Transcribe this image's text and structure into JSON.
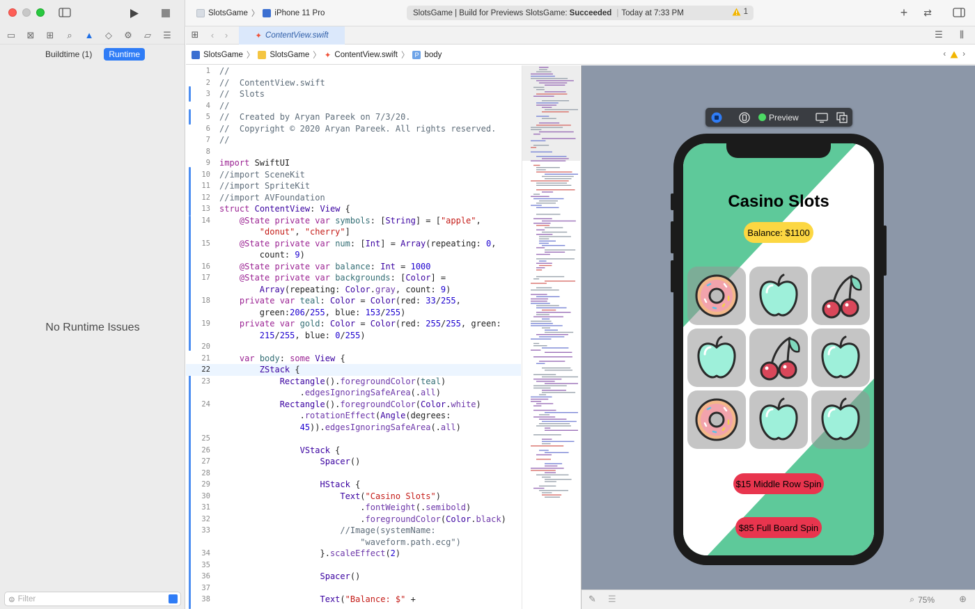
{
  "titlebar": {
    "scheme_project": "SlotsGame",
    "scheme_device": "iPhone 11 Pro",
    "activity_prefix": "SlotsGame | Build for Previews SlotsGame:",
    "activity_status": "Succeeded",
    "activity_time": "Today at 7:33 PM",
    "warning_count": "1"
  },
  "navigator": {
    "segments": [
      "Buildtime (1)",
      "Runtime"
    ],
    "selected_segment": "Runtime",
    "empty_message": "No Runtime Issues",
    "filter_placeholder": "Filter"
  },
  "editor": {
    "tab_label": "ContentView.swift",
    "breadcrumb": [
      "SlotsGame",
      "SlotsGame",
      "ContentView.swift",
      "body"
    ],
    "current_line": "22"
  },
  "code_lines": [
    {
      "n": "1",
      "html": "<span class=\"cm\">//</span>"
    },
    {
      "n": "2",
      "html": "<span class=\"cm\">//  ContentView.swift</span>"
    },
    {
      "n": "3",
      "html": "<span class=\"cm\">//  Slots</span>"
    },
    {
      "n": "4",
      "html": "<span class=\"cm\">//</span>"
    },
    {
      "n": "5",
      "html": "<span class=\"cm\">//  Created by Aryan Pareek on 7/3/20.</span>"
    },
    {
      "n": "6",
      "html": "<span class=\"cm\">//  Copyright © 2020 Aryan Pareek. All rights reserved.</span>"
    },
    {
      "n": "7",
      "html": "<span class=\"cm\">//</span>"
    },
    {
      "n": "8",
      "html": ""
    },
    {
      "n": "9",
      "html": "<span class=\"kw\">import</span> SwiftUI"
    },
    {
      "n": "10",
      "html": "<span class=\"cm\">//import SceneKit</span>"
    },
    {
      "n": "11",
      "html": "<span class=\"cm\">//import SpriteKit</span>"
    },
    {
      "n": "12",
      "html": "<span class=\"cm\">//import AVFoundation</span>"
    },
    {
      "n": "13",
      "html": "<span class=\"kw\">struct</span> <span class=\"ty\">ContentView</span>: <span class=\"ty\">View</span> {"
    },
    {
      "n": "14",
      "html": "    <span class=\"kw\">@State private var</span> <span class=\"pr\">symbols</span>: [<span class=\"ty\">String</span>] = [<span class=\"st\">\"apple\"</span>,"
    },
    {
      "n": "",
      "html": "        <span class=\"st\">\"donut\"</span>, <span class=\"st\">\"cherry\"</span>]"
    },
    {
      "n": "15",
      "html": "    <span class=\"kw\">@State private var</span> <span class=\"pr\">num</span>: [<span class=\"ty\">Int</span>] = <span class=\"ty\">Array</span>(repeating: <span class=\"nm\">0</span>,"
    },
    {
      "n": "",
      "html": "        count: <span class=\"nm\">9</span>)"
    },
    {
      "n": "16",
      "html": "    <span class=\"kw\">@State private var</span> <span class=\"pr\">balance</span>: <span class=\"ty\">Int</span> = <span class=\"nm\">1000</span>"
    },
    {
      "n": "17",
      "html": "    <span class=\"kw\">@State private var</span> <span class=\"pr\">backgrounds</span>: [<span class=\"ty\">Color</span>] ="
    },
    {
      "n": "",
      "html": "        <span class=\"ty\">Array</span>(repeating: <span class=\"ty\">Color</span>.<span class=\"fn\">gray</span>, count: <span class=\"nm\">9</span>)"
    },
    {
      "n": "18",
      "html": "    <span class=\"kw\">private var</span> <span class=\"pr\">teal</span>: <span class=\"ty\">Color</span> = <span class=\"ty\">Color</span>(red: <span class=\"nm\">33</span>/<span class=\"nm\">255</span>,"
    },
    {
      "n": "",
      "html": "        green:<span class=\"nm\">206</span>/<span class=\"nm\">255</span>, blue: <span class=\"nm\">153</span>/<span class=\"nm\">255</span>)"
    },
    {
      "n": "19",
      "html": "    <span class=\"kw\">private var</span> <span class=\"pr\">gold</span>: <span class=\"ty\">Color</span> = <span class=\"ty\">Color</span>(red: <span class=\"nm\">255</span>/<span class=\"nm\">255</span>, green:"
    },
    {
      "n": "",
      "html": "        <span class=\"nm\">215</span>/<span class=\"nm\">255</span>, blue: <span class=\"nm\">0</span>/<span class=\"nm\">255</span>)"
    },
    {
      "n": "20",
      "html": ""
    },
    {
      "n": "21",
      "html": "    <span class=\"kw\">var</span> <span class=\"pr\">body</span>: <span class=\"kw\">some</span> <span class=\"ty\">View</span> {"
    },
    {
      "n": "22",
      "html": "        <span class=\"ty\">ZStack</span> {"
    },
    {
      "n": "23",
      "html": "            <span class=\"ty\">Rectangle</span>().<span class=\"fn\">foregroundColor</span>(<span class=\"pr\">teal</span>)"
    },
    {
      "n": "",
      "html": "                .<span class=\"fn\">edgesIgnoringSafeArea</span>(.<span class=\"fn\">all</span>)"
    },
    {
      "n": "24",
      "html": "            <span class=\"ty\">Rectangle</span>().<span class=\"fn\">foregroundColor</span>(<span class=\"ty\">Color</span>.<span class=\"fn\">white</span>)"
    },
    {
      "n": "",
      "html": "                .<span class=\"fn\">rotationEffect</span>(<span class=\"ty\">Angle</span>(degrees:"
    },
    {
      "n": "",
      "html": "                <span class=\"nm\">45</span>)).<span class=\"fn\">edgesIgnoringSafeArea</span>(.<span class=\"fn\">all</span>)"
    },
    {
      "n": "25",
      "html": ""
    },
    {
      "n": "26",
      "html": "                <span class=\"ty\">VStack</span> {"
    },
    {
      "n": "27",
      "html": "                    <span class=\"ty\">Spacer</span>()"
    },
    {
      "n": "28",
      "html": ""
    },
    {
      "n": "29",
      "html": "                    <span class=\"ty\">HStack</span> {"
    },
    {
      "n": "30",
      "html": "                        <span class=\"ty\">Text</span>(<span class=\"st\">\"Casino Slots\"</span>)"
    },
    {
      "n": "31",
      "html": "                            .<span class=\"fn\">fontWeight</span>(.<span class=\"fn\">semibold</span>)"
    },
    {
      "n": "32",
      "html": "                            .<span class=\"fn\">foregroundColor</span>(<span class=\"ty\">Color</span>.<span class=\"fn\">black</span>)"
    },
    {
      "n": "33",
      "html": "                        <span class=\"cm\">//Image(systemName:</span>"
    },
    {
      "n": "",
      "html": "                            <span class=\"cm\">\"waveform.path.ecg\")</span>"
    },
    {
      "n": "34",
      "html": "                    }.<span class=\"fn\">scaleEffect</span>(<span class=\"nm\">2</span>)"
    },
    {
      "n": "35",
      "html": ""
    },
    {
      "n": "36",
      "html": "                    <span class=\"ty\">Spacer</span>()"
    },
    {
      "n": "37",
      "html": ""
    },
    {
      "n": "38",
      "html": "                    <span class=\"ty\">Text</span>(<span class=\"st\">\"Balance: $\"</span> +"
    }
  ],
  "preview": {
    "label": "Preview",
    "app_title": "Casino Slots",
    "balance_text": "Balance: $1100",
    "slots": [
      "donut",
      "apple",
      "cherry",
      "apple",
      "cherry",
      "apple",
      "donut",
      "apple",
      "apple"
    ],
    "button_middle": "$15 Middle Row Spin",
    "button_full": "$85 Full Board Spin",
    "zoom": "75%"
  },
  "colors": {
    "teal": "#5ec99a",
    "gold": "#fcd742",
    "red": "#e8354e",
    "accent": "#2f7cf6"
  }
}
